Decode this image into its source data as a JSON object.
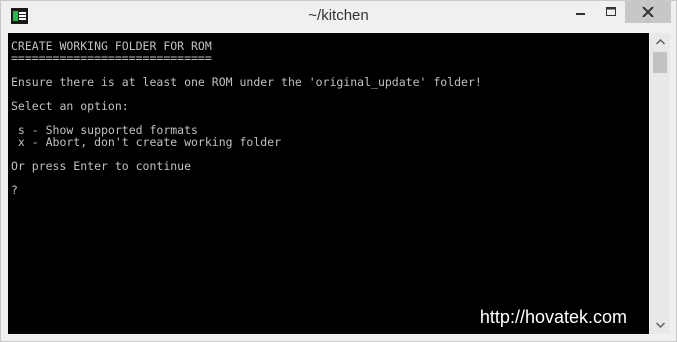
{
  "window": {
    "title": "~/kitchen",
    "app_icon": "terminal-icon"
  },
  "console": {
    "lines": [
      "CREATE WORKING FOLDER FOR ROM",
      "=============================",
      "",
      "Ensure there is at least one ROM under the 'original_update' folder!",
      "",
      "Select an option:",
      "",
      " s - Show supported formats",
      " x - Abort, don't create working folder",
      "",
      "Or press Enter to continue",
      "",
      "?"
    ]
  },
  "watermark": "http://hovatek.com",
  "colors": {
    "console_bg": "#000000",
    "console_text": "#c0c0c0",
    "titlebar_bg": "#f0f0f0",
    "close_btn_bg": "#c7c7c7"
  }
}
